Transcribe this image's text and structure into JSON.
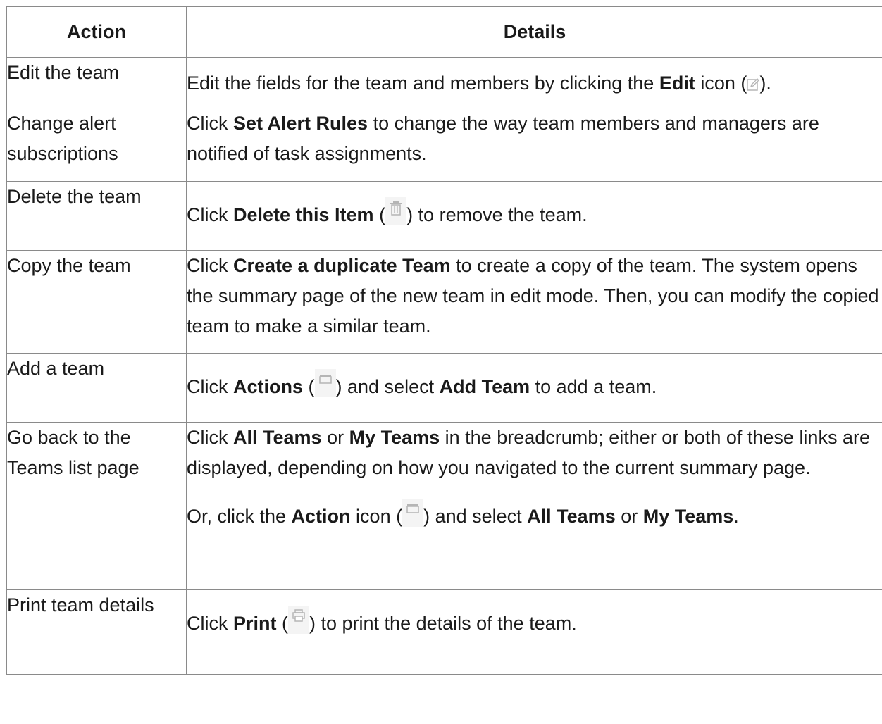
{
  "headers": {
    "action": "Action",
    "details": "Details"
  },
  "rows": [
    {
      "action": "Edit the team",
      "details": {
        "pre": "Edit the fields for the team and members by clicking the ",
        "b1": "Edit",
        "mid": " icon (",
        "post": ")."
      }
    },
    {
      "action": "Change alert subscriptions",
      "details": {
        "pre": "Click ",
        "b1": "Set Alert Rules",
        "post": " to change the way team members and managers are notified of task assignments."
      }
    },
    {
      "action": "Delete the team",
      "details": {
        "pre": "Click ",
        "b1": "Delete this Item",
        "mid": " (",
        "post": ") to remove the team."
      }
    },
    {
      "action": "Copy the team",
      "details": {
        "pre": "Click ",
        "b1": "Create a duplicate Team",
        "post": " to create a copy of the team. The system opens the summary page of the new team in edit mode. Then, you can modify the copied team to make a similar team."
      }
    },
    {
      "action": "Add a team",
      "details": {
        "pre": "Click ",
        "b1": "Actions",
        "mid": " (",
        "mid2": ") and select ",
        "b2": "Add Team",
        "post": " to add a team."
      }
    },
    {
      "action": "Go back to the Teams list page",
      "details": {
        "p1_pre": "Click ",
        "p1_b1": "All Teams",
        "p1_mid": " or ",
        "p1_b2": "My Teams",
        "p1_post": " in the breadcrumb; either or both of these links are displayed, depending on how you navigated to the current summary page.",
        "p2_pre": "Or, click the ",
        "p2_b1": "Action",
        "p2_mid": " icon (",
        "p2_mid2": ") and select ",
        "p2_b2": "All Teams",
        "p2_mid3": " or ",
        "p2_b3": "My Teams",
        "p2_post": "."
      }
    },
    {
      "action": "Print team details",
      "details": {
        "pre": "Click ",
        "b1": "Print",
        "mid": " (",
        "post": ") to print the details of the team."
      }
    }
  ],
  "icons": {
    "edit": "edit-icon",
    "delete": "trash-icon",
    "actions": "folder-icon",
    "print": "printer-icon"
  },
  "colors": {
    "border": "#8a8a8a",
    "icon": "#b5b5b5",
    "icon_bg": "#f4f4f4",
    "text": "#1a1a1a"
  }
}
